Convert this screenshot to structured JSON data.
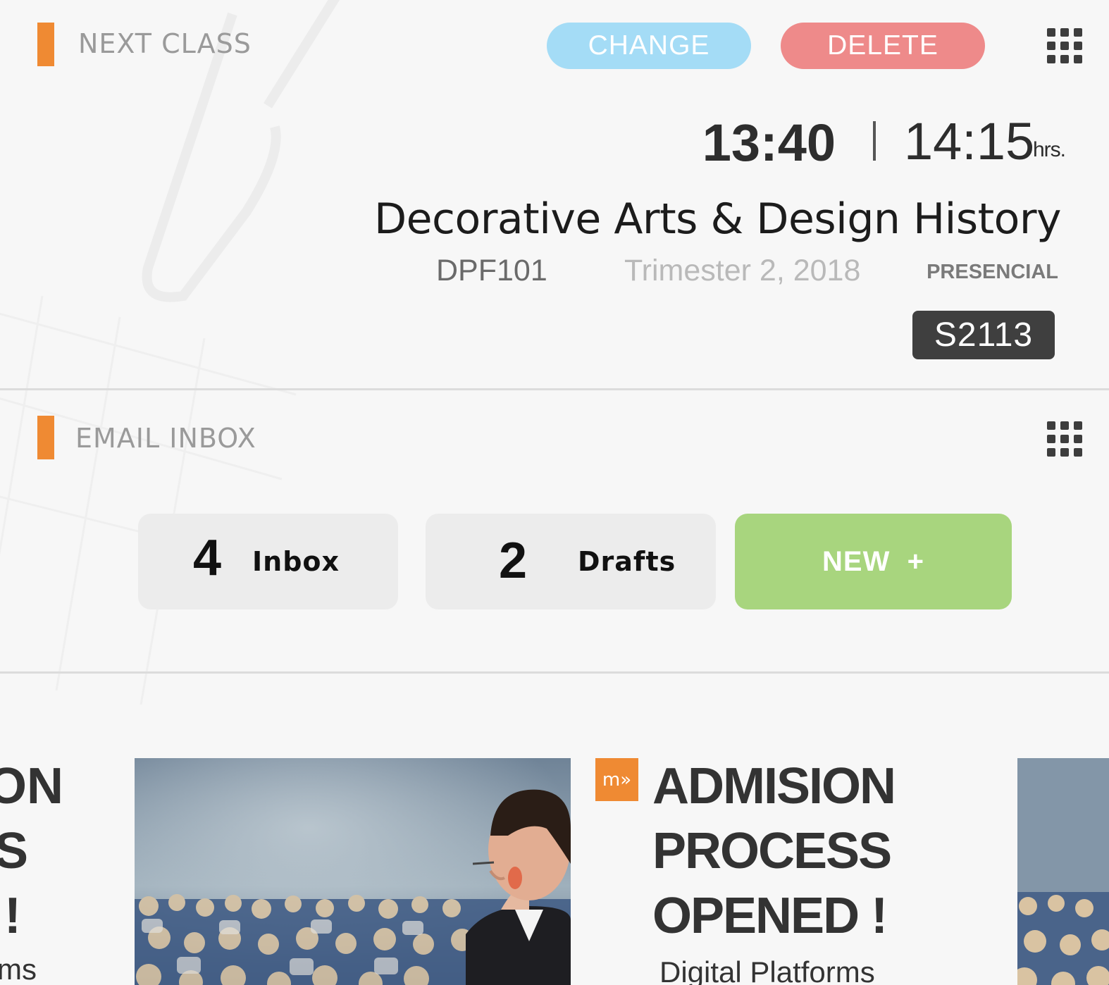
{
  "next_class": {
    "section_label": "NEXT CLASS",
    "change_label": "CHANGE",
    "delete_label": "DELETE",
    "start_time": "13:40",
    "end_time": "14:15",
    "time_unit": "hrs.",
    "course_title": "Decorative Arts & Design History",
    "course_code": "DPF101",
    "term": "Trimester 2, 2018",
    "mode": "PRESENCIAL",
    "room": "S2113"
  },
  "email_inbox": {
    "section_label": "EMAIL INBOX",
    "inbox_count": "4",
    "inbox_label": "Inbox",
    "drafts_count": "2",
    "drafts_label": "Drafts",
    "new_label": "NEW  +"
  },
  "news": {
    "prev_fragment_lines": [
      "ON",
      "S",
      "!",
      "rms"
    ],
    "logo_text": "m»",
    "headline_lines": [
      "ADMISION",
      "PROCESS",
      "OPENED !"
    ],
    "subtitle": "Digital Platforms"
  },
  "colors": {
    "accent": "#ef8a33",
    "change_button": "#a4dcf6",
    "delete_button": "#ee8a8a",
    "new_button": "#a8d57e",
    "room_badge": "#3f3f3f"
  },
  "icons": [
    "grid-menu-icon",
    "brand-logo-icon"
  ]
}
